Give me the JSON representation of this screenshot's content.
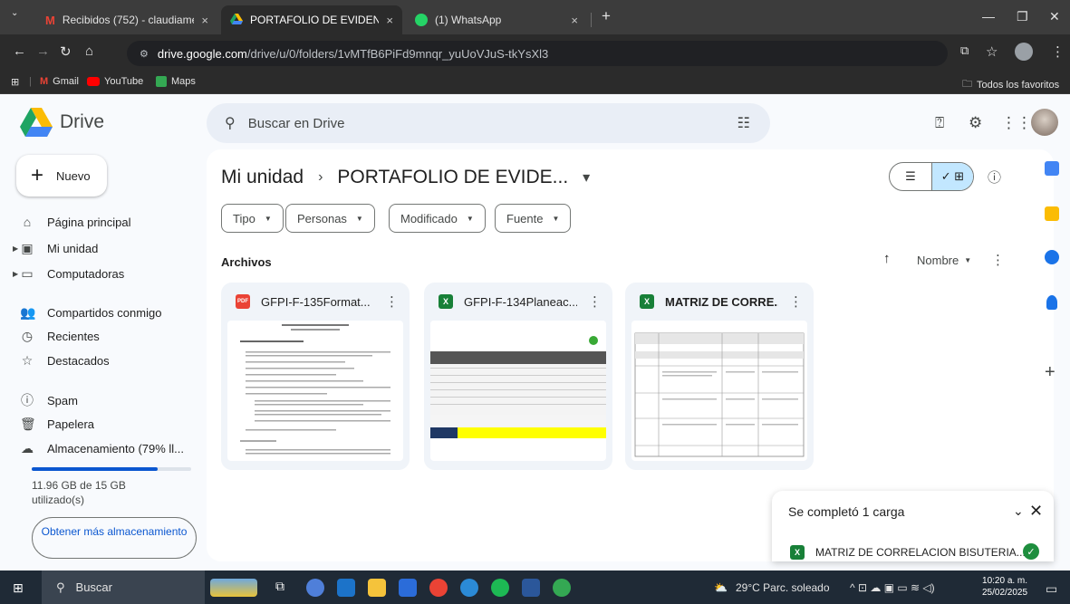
{
  "browser": {
    "tabs": [
      {
        "title": "Recibidos (752) - claudiamendo",
        "close": "×"
      },
      {
        "title": "PORTAFOLIO DE EVIDENCIAS D",
        "close": "×"
      },
      {
        "title": "(1) WhatsApp",
        "close": "×"
      }
    ],
    "new_tab": "+",
    "url_host": "drive.google.com",
    "url_path": "/drive/u/0/folders/1vMTfB6PiFd9mnqr_yuUoVJuS-tkYsXl3",
    "bookmarks": [
      "Gmail",
      "YouTube",
      "Maps"
    ],
    "favorites_label": "Todos los favoritos"
  },
  "drive": {
    "logo": "Drive",
    "search_placeholder": "Buscar en Drive",
    "new_button": "Nuevo",
    "nav": {
      "home": "Página principal",
      "my_drive": "Mi unidad",
      "computers": "Computadoras",
      "shared": "Compartidos conmigo",
      "recent": "Recientes",
      "starred": "Destacados",
      "spam": "Spam",
      "trash": "Papelera",
      "storage": "Almacenamiento (79% ll..."
    },
    "storage_fraction": 0.79,
    "storage_text": "11.96 GB de 15 GB utilizado(s)",
    "get_more": "Obtener más almacenamiento",
    "breadcrumb": {
      "root": "Mi unidad",
      "sep": "›",
      "current": "PORTAFOLIO DE EVIDE...",
      "dropdown": "▾"
    },
    "filters": [
      "Tipo",
      "Personas",
      "Modificado",
      "Fuente"
    ],
    "section_title": "Archivos",
    "sort_label": "Nombre",
    "files": [
      {
        "name": "GFPI-F-135Format...",
        "type_label": "PDF"
      },
      {
        "name": "GFPI-F-134Planeac...",
        "type_label": "X"
      },
      {
        "name": "MATRIZ DE CORRE...",
        "type_label": "X"
      }
    ]
  },
  "upload_toast": {
    "title": "Se completó 1 carga",
    "file_name": "MATRIZ DE CORRELACION BISUTERIA....",
    "type_label": "X"
  },
  "taskbar": {
    "search": "Buscar",
    "weather": "29°C  Parc. soleado",
    "time": "10:20 a. m.",
    "date": "25/02/2025"
  },
  "colors": {
    "accent": "#0b57d0",
    "excel": "#188038",
    "pdf": "#ea4335",
    "selected": "#c2e7ff"
  }
}
